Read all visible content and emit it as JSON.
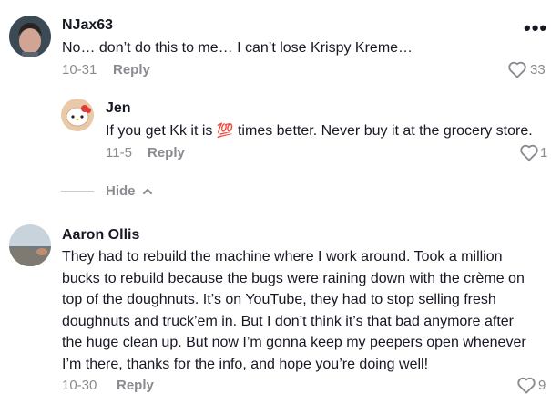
{
  "comments": [
    {
      "username": "NJax63",
      "text": "No… don’t do this to me… I can’t lose Krispy Kreme…",
      "date": "10-31",
      "reply_label": "Reply",
      "likes": "33",
      "more_label": "•••",
      "replies": [
        {
          "username": "Jen",
          "text_before_emoji": "If you get Kk it is",
          "emoji": "💯",
          "text_after_emoji": "times better. Never buy it at the grocery store.",
          "date": "11-5",
          "reply_label": "Reply",
          "likes": "1"
        }
      ],
      "hide_label": "Hide"
    },
    {
      "username": "Aaron Ollis",
      "text_lines": [
        "They had to rebuild the machine where I work around. Took a million",
        "bucks to rebuild because the bugs were raining down with the crème on",
        "top of the doughnuts. It’s on YouTube, they had to stop selling fresh",
        "doughnuts and truck’em in. But I don’t think it’s that bad anymore after",
        "the huge clean up. But now I’m gonna keep my peepers open whenever",
        "I’m there, thanks for the info, and hope you’re doing well!"
      ],
      "date": "10-30",
      "reply_label": "Reply",
      "likes": "9"
    }
  ],
  "icons": {
    "heart": "heart-outline-icon",
    "chevron": "chevron-up-icon",
    "more": "more-dots-icon"
  },
  "colors": {
    "text": "#161823",
    "muted": "#8a8b91",
    "divider": "#c9cacd"
  }
}
